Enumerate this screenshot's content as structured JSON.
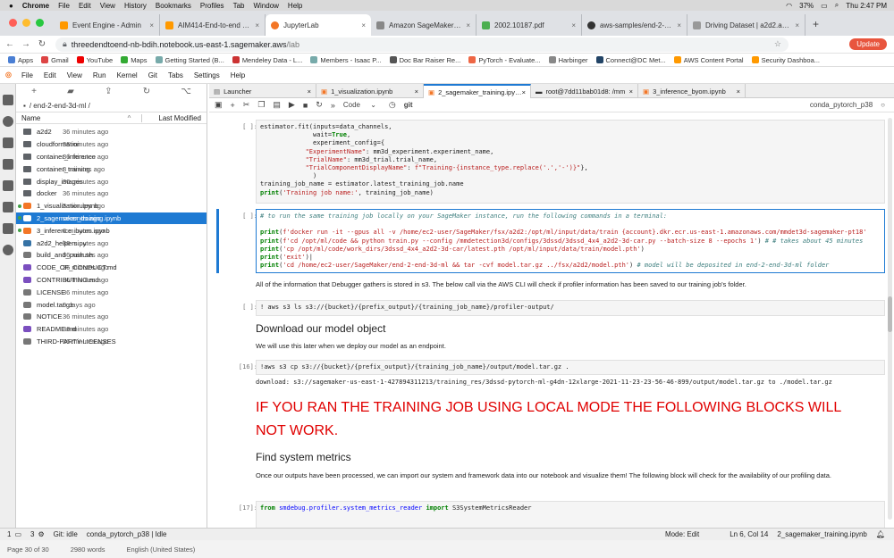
{
  "mac_menu": {
    "app": "Chrome",
    "items": [
      "File",
      "Edit",
      "View",
      "History",
      "Bookmarks",
      "Profiles",
      "Tab",
      "Window",
      "Help"
    ],
    "battery": "37%",
    "clock": "Thu 2:47 PM"
  },
  "browser_tabs": [
    {
      "title": "Event Engine - Admin",
      "color": "#ff9900"
    },
    {
      "title": "AIM414-End-to-end 3D Machine",
      "color": "#ff9900"
    },
    {
      "title": "JupyterLab",
      "color": "#f37626",
      "active": true
    },
    {
      "title": "Amazon SageMaker Ground Truth",
      "color": "#777"
    },
    {
      "title": "2002.10187.pdf",
      "color": "#777"
    },
    {
      "title": "aws-samples/end-2-end-3d-ml",
      "color": "#333"
    },
    {
      "title": "Driving Dataset | a2d2.audi",
      "color": "#777"
    }
  ],
  "address": {
    "url_host": "threedendtoend-nb-bdih.notebook.us-east-1.sagemaker.aws",
    "url_path": "/lab",
    "update_label": "Update"
  },
  "bookmarks": [
    "Apps",
    "Gmail",
    "YouTube",
    "Maps",
    "Getting Started (B...",
    "Mendeley Data - L...",
    "Members - Isaac P...",
    "Doc Bar Raiser Re...",
    "PyTorch - Evaluate...",
    "Harbinger",
    "Connect@DC Met...",
    "AWS Content Portal",
    "Security Dashboa..."
  ],
  "jupyter_menu": [
    "File",
    "Edit",
    "View",
    "Run",
    "Kernel",
    "Git",
    "Tabs",
    "Settings",
    "Help"
  ],
  "file_browser": {
    "breadcrumb": "/ end-2-end-3d-ml /",
    "col_name": "Name",
    "col_modified": "Last Modified",
    "files": [
      {
        "name": "a2d2",
        "modified": "36 minutes ago",
        "type": "folder"
      },
      {
        "name": "cloudformation",
        "modified": "36 minutes ago",
        "type": "folder"
      },
      {
        "name": "container_inference",
        "modified": "36 minutes ago",
        "type": "folder"
      },
      {
        "name": "container_training",
        "modified": "3 minutes ago",
        "type": "folder"
      },
      {
        "name": "display_images",
        "modified": "36 minutes ago",
        "type": "folder"
      },
      {
        "name": "docker",
        "modified": "36 minutes ago",
        "type": "folder"
      },
      {
        "name": "1_visualization.ipynb",
        "modified": "5 minutes ago",
        "type": "notebook",
        "running": true
      },
      {
        "name": "2_sagemaker_training.ipynb",
        "modified": "seconds ago",
        "type": "notebook",
        "running": true,
        "selected": true
      },
      {
        "name": "3_inference_byom.ipynb",
        "modified": "6 minutes ago",
        "type": "notebook",
        "running": true
      },
      {
        "name": "a2d2_helpers.py",
        "modified": "36 minutes ago",
        "type": "python"
      },
      {
        "name": "build_and_push.sh",
        "modified": "36 minutes ago",
        "type": "file"
      },
      {
        "name": "CODE_OF_CONDUCT.md",
        "modified": "36 minutes ago",
        "type": "markdown"
      },
      {
        "name": "CONTRIBUTING.md",
        "modified": "36 minutes ago",
        "type": "markdown"
      },
      {
        "name": "LICENSE",
        "modified": "36 minutes ago",
        "type": "file"
      },
      {
        "name": "model.tar.gz",
        "modified": "9 days ago",
        "type": "file"
      },
      {
        "name": "NOTICE",
        "modified": "36 minutes ago",
        "type": "file"
      },
      {
        "name": "README.md",
        "modified": "36 minutes ago",
        "type": "markdown"
      },
      {
        "name": "THIRD-PARTY-LICENSES",
        "modified": "36 minutes ago",
        "type": "file"
      }
    ]
  },
  "doc_tabs": [
    {
      "title": "Launcher"
    },
    {
      "title": "1_visualization.ipynb"
    },
    {
      "title": "2_sagemaker_training.ipynb",
      "active": true
    },
    {
      "title": "root@7dd11bab01d8: /mm"
    },
    {
      "title": "3_inference_byom.ipynb"
    }
  ],
  "notebook_toolbar": {
    "cell_type": "Code",
    "kernel": "conda_pytorch_p38"
  },
  "cells": {
    "c1_prompt": "[ ]:",
    "c2_prompt": "[ ]:",
    "c3_prompt": "[ ]:",
    "c4_prompt": "[16]:",
    "c5_prompt": "[17]:",
    "c2_comment": "# to run the same training job locally on your SageMaker instance, run the following commands in a terminal:",
    "md_debugger": "All of the information that Debugger gathers is stored in s3. The below call via the AWS CLI will check if profiler information has been saved to our training job's folder.",
    "c3_code": "! aws s3 ls s3://{bucket}/{prefix_output}/{training_job_name}/profiler-output/",
    "h_download": "Download our model object",
    "md_later": "We will use this later when we deploy our model as an endpoint.",
    "c4_code": "!aws s3 cp s3://{bucket}/{prefix_output}/{training_job_name}/output/model.tar.gz .",
    "c4_output": "download: s3://sagemaker-us-east-1-427894311213/training_res/3dssd-pytorch-ml-g4dn-12xlarge-2021-11-23-23-56-46-899/output/model.tar.gz to ./model.tar.gz",
    "warning": "IF YOU RAN THE TRAINING JOB USING LOCAL MODE THE FOLLOWING BLOCKS WILL NOT WORK.",
    "h_metrics": "Find system metrics",
    "md_metrics": "Once our outputs have been processed, we can import our system and framework data into our notebook and visualize them! The following block will check for the availability of our profiling data.",
    "c5_from": "from",
    "c5_module": "smdebug.profiler.system_metrics_reader",
    "c5_import": "import",
    "c5_name": "S3SystemMetricsReader"
  },
  "status": {
    "left1": "1",
    "left2": "3",
    "git": "Git: idle",
    "kernel": "conda_pytorch_p38 | Idle",
    "mode": "Mode: Edit",
    "position": "Ln 6, Col 14",
    "file": "2_sagemaker_training.ipynb"
  },
  "wordbar": {
    "page": "Page 30 of 30",
    "words": "2980 words",
    "lang": "English (United States)"
  }
}
